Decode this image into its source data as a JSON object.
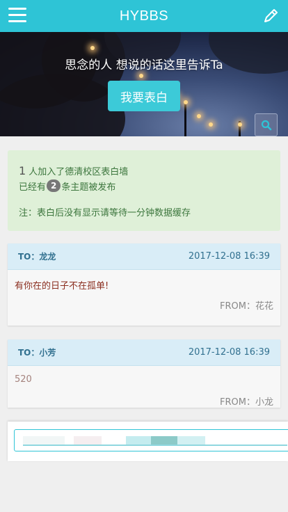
{
  "header": {
    "title": "HYBBS",
    "menu_icon": "hamburger-menu-icon",
    "edit_icon": "pencil-icon"
  },
  "hero": {
    "tagline": "思念的人 想说的话这里告诉Ta",
    "button_label": "我要表白",
    "search_icon": "search-icon"
  },
  "info": {
    "member_count": "1",
    "member_text": "人加入了德清校区表白墙",
    "topics_prefix": "已经有",
    "topics_count": "2",
    "topics_suffix": "条主题被发布",
    "note": "注：表白后没有显示请等待一分钟数据缓存"
  },
  "posts": [
    {
      "to": "TO：龙龙",
      "time": "2017-12-08 16:39",
      "message": "有你在的日子不在孤单!",
      "from": "FROM：花花"
    },
    {
      "to": "TO：小芳",
      "time": "2017-12-08 16:39",
      "message": "520",
      "from": "FROM：小龙"
    }
  ],
  "colors": {
    "accent": "#2ec4d6",
    "info_bg": "#dff0d8",
    "info_text": "#3c763d",
    "card_head_bg": "#d9edf7",
    "card_head_text": "#31708f"
  }
}
